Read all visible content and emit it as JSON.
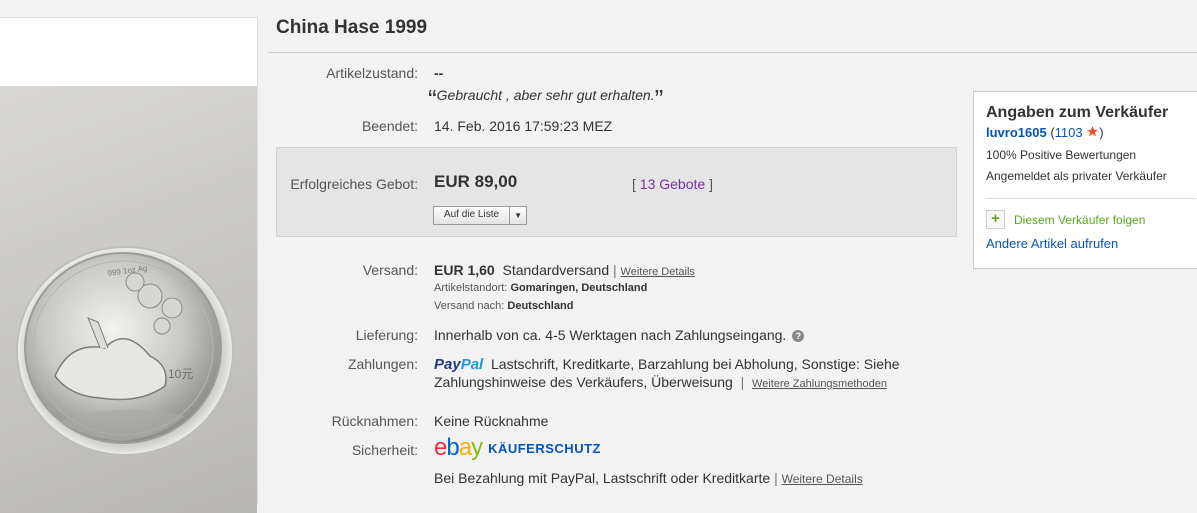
{
  "listing": {
    "title": "China Hase 1999",
    "condition_label": "Artikelzustand:",
    "condition_value": "--",
    "condition_quote": "Gebraucht , aber sehr gut erhalten.",
    "quote_open": "“",
    "quote_close": "”",
    "ended_label": "Beendet:",
    "ended_value": "14. Feb. 2016  17:59:23 MEZ"
  },
  "bid": {
    "label": "Erfolgreiches Gebot:",
    "price": "EUR 89,00",
    "bids_open": "[",
    "bids_link": "13 Gebote",
    "bids_close": "]",
    "watch_label": "Auf die Liste",
    "watch_arrow": "▼"
  },
  "shipping": {
    "label": "Versand:",
    "price": "EUR 1,60",
    "method": "Standardversand",
    "sep": "|",
    "details_link": "Weitere Details",
    "location_label": "Artikelstandort:",
    "location_value": "Gomaringen, Deutschland",
    "ships_to_label": "Versand nach:",
    "ships_to_value": "Deutschland"
  },
  "delivery": {
    "label": "Lieferung:",
    "value": "Innerhalb von ca. 4-5 Werktagen nach Zahlungseingang.",
    "help_icon": "?"
  },
  "payments": {
    "label": "Zahlungen:",
    "paypal_part1": "Pay",
    "paypal_part2": "Pal",
    "line1": "Lastschrift,  Kreditkarte,  Barzahlung bei Abholung,  Sonstige: Siehe",
    "line2": "Zahlungshinweise des Verkäufers,  Überweisung",
    "sep": "|",
    "more_link": "Weitere Zahlungsmethoden"
  },
  "returns": {
    "label": "Rücknahmen:",
    "value": "Keine Rücknahme"
  },
  "security": {
    "label": "Sicherheit:",
    "logo_e": "e",
    "logo_b": "b",
    "logo_a": "a",
    "logo_y": "y",
    "protection": "KÄUFERSCHUTZ",
    "text": "Bei Bezahlung mit PayPal, Lastschrift oder Kreditkarte",
    "sep": "|",
    "details_link": "Weitere Details"
  },
  "seller": {
    "heading": "Angaben zum Verkäufer",
    "username": "luvro1605",
    "feedback_count": "1103",
    "positive": "100% Positive Bewertungen",
    "registered": "Angemeldet als privater Verkäufer",
    "follow_label": "Diesem Verkäufer folgen",
    "follow_icon": "+",
    "other_items": "Andere Artikel aufrufen",
    "star_color": "#e8542c"
  },
  "coin": {
    "inscription": "999 1oz Ag",
    "denomination": "10元"
  },
  "colors": {
    "link": "#0654ba",
    "bids_link": "#7530a0",
    "follow_green": "#5ba71b"
  }
}
